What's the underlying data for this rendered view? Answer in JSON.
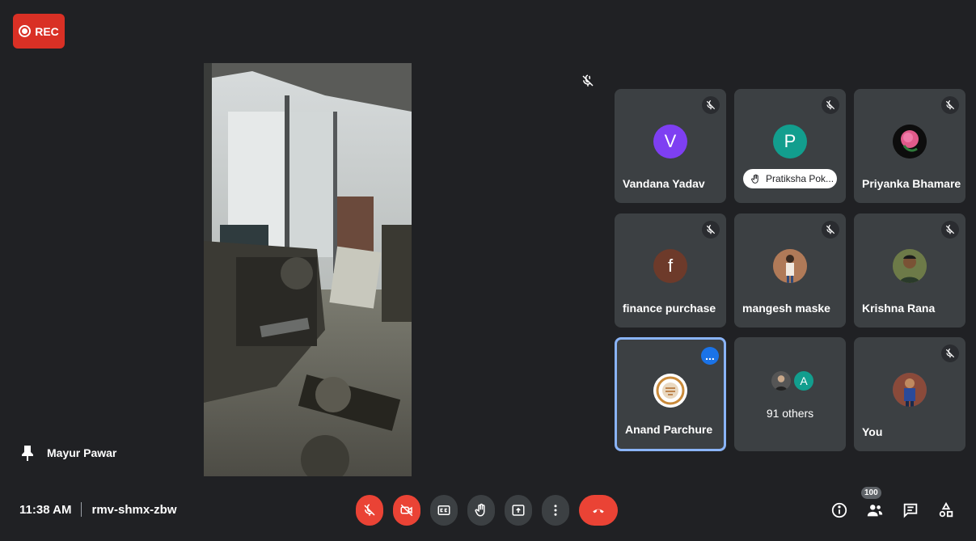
{
  "recording": {
    "label": "REC"
  },
  "presenter": {
    "name": "Mayur Pawar"
  },
  "meeting": {
    "time": "11:38 AM",
    "code": "rmv-shmx-zbw"
  },
  "colors": {
    "background": "#202124",
    "tile": "#3c4043",
    "red": "#ea4335",
    "accent": "#1a73e8",
    "active_border": "#8ab4f8"
  },
  "tiles": [
    {
      "name": "Vandana Yadav",
      "initial": "V",
      "avatar_color": "#7e3ff2",
      "muted": true
    },
    {
      "name": "Pratiksha Pok...",
      "initial": "P",
      "avatar_color": "#129e8e",
      "muted": true,
      "hand_raised": true
    },
    {
      "name": "Priyanka Bhamare",
      "avatar": "rose-photo",
      "muted": true
    },
    {
      "name": "finance purchase",
      "initial": "f",
      "avatar_color": "#6d3a2a",
      "muted": true
    },
    {
      "name": "mangesh maske",
      "avatar": "person-photo",
      "muted": true
    },
    {
      "name": "Krishna Rana",
      "avatar": "person-photo",
      "muted": true
    },
    {
      "name": "Anand Parchure",
      "avatar": "logo-photo",
      "muted": false,
      "active": true,
      "more": "..."
    },
    {
      "others_label": "91 others",
      "mini_initial": "A",
      "mini_color": "#129e8e"
    },
    {
      "name": "You",
      "avatar": "person-photo",
      "muted": true
    }
  ],
  "people_count": "100",
  "icons": {
    "mic": "mic-off-icon",
    "camera": "camera-off-icon",
    "captions": "captions-icon",
    "hand": "raise-hand-icon",
    "present": "present-icon",
    "more": "more-vert-icon",
    "end": "end-call-icon",
    "info": "info-icon",
    "people": "people-icon",
    "chat": "chat-icon",
    "activities": "activities-icon"
  }
}
